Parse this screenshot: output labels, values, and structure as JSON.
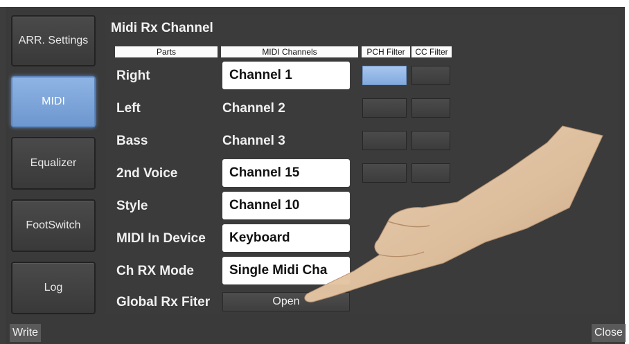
{
  "sidebar": {
    "items": [
      {
        "label": "ARR. Settings",
        "active": false
      },
      {
        "label": "MIDI",
        "active": true
      },
      {
        "label": "Equalizer",
        "active": false
      },
      {
        "label": "FootSwitch",
        "active": false
      },
      {
        "label": "Log",
        "active": false
      }
    ]
  },
  "panel": {
    "title": "Midi Rx Channel",
    "headers": {
      "parts": "Parts",
      "midi_channels": "MIDI Channels",
      "pch_filter": "PCH Filter",
      "cc_filter": "CC Filter"
    },
    "rows": [
      {
        "label": "Right",
        "value": "Channel 1",
        "editable": true,
        "pch_on": true,
        "cc_on": false
      },
      {
        "label": "Left",
        "value": "Channel 2",
        "editable": false,
        "pch_on": false,
        "cc_on": false
      },
      {
        "label": "Bass",
        "value": "Channel 3",
        "editable": false,
        "pch_on": false,
        "cc_on": false
      },
      {
        "label": "2nd Voice",
        "value": "Channel 15",
        "editable": true,
        "pch_on": false,
        "cc_on": false
      },
      {
        "label": "Style",
        "value": "Channel 10",
        "editable": true
      },
      {
        "label": "MIDI In Device",
        "value": "Keyboard",
        "editable": true
      },
      {
        "label": "Ch RX Mode",
        "value": "Single Midi Cha",
        "editable": true
      }
    ],
    "global_rx_filter": {
      "label": "Global Rx Fiter",
      "button": "Open"
    }
  },
  "footer": {
    "write": "Write",
    "close": "Close"
  },
  "colors": {
    "active_blue": "#7aa3db",
    "background": "#3b3b3b"
  },
  "icons": {
    "overlay": "pointing-hand-icon"
  }
}
